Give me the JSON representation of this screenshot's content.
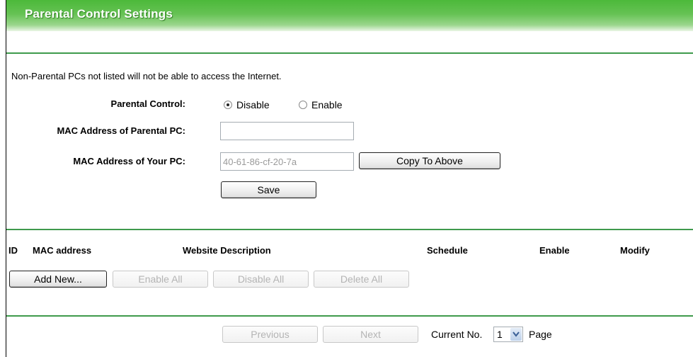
{
  "page": {
    "title": "Parental Control Settings",
    "notice": "Non-Parental PCs not listed will not be able to access the Internet."
  },
  "form": {
    "parental_control_label": "Parental Control:",
    "option_disable": "Disable",
    "option_enable": "Enable",
    "selected_option": "Disable",
    "mac_parental_label": "MAC Address of Parental PC:",
    "mac_parental_value": "",
    "mac_your_label": "MAC Address of Your PC:",
    "mac_your_value": "40-61-86-cf-20-7a",
    "copy_button": "Copy To Above",
    "save_button": "Save"
  },
  "table": {
    "columns": [
      "ID",
      "MAC address",
      "Website Description",
      "Schedule",
      "Enable",
      "Modify"
    ]
  },
  "actions": {
    "add_new": "Add New...",
    "enable_all": "Enable All",
    "disable_all": "Disable All",
    "delete_all": "Delete All"
  },
  "pagination": {
    "previous": "Previous",
    "next": "Next",
    "current_label": "Current No.",
    "current_value": "1",
    "page_label": "Page"
  },
  "colors": {
    "title_green": "#4cb93a",
    "rule_green": "#3f9a4c"
  }
}
